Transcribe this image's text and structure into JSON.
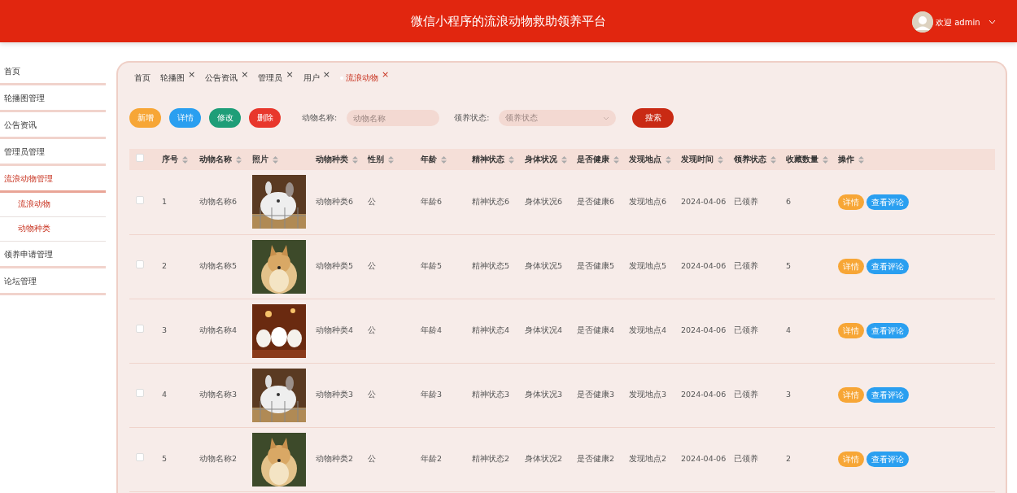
{
  "header": {
    "title": "微信小程序的流浪动物救助领养平台",
    "user": "欢迎 admin"
  },
  "sidebar": {
    "items": [
      {
        "label": "首页",
        "selected": false
      },
      {
        "label": "轮播图管理",
        "selected": false
      },
      {
        "label": "公告资讯",
        "selected": false
      },
      {
        "label": "管理员管理",
        "selected": false
      },
      {
        "label": "流浪动物管理",
        "selected": true,
        "expanded": true,
        "children": [
          {
            "label": "流浪动物",
            "selected": false
          },
          {
            "label": "动物种类",
            "selected": false
          }
        ]
      },
      {
        "label": "领养申请管理",
        "selected": false
      },
      {
        "label": "论坛管理",
        "selected": false
      }
    ]
  },
  "tabs": [
    {
      "label": "首页",
      "closable": false,
      "selected": false
    },
    {
      "label": "轮播图",
      "closable": true,
      "selected": false
    },
    {
      "label": "公告资讯",
      "closable": true,
      "selected": false
    },
    {
      "label": "管理员",
      "closable": true,
      "selected": false
    },
    {
      "label": "用户",
      "closable": true,
      "selected": false
    },
    {
      "label": "流浪动物",
      "closable": true,
      "selected": true
    }
  ],
  "close_glyph": "×",
  "actions": [
    {
      "label": "新增",
      "color": "#f7a636"
    },
    {
      "label": "详情",
      "color": "#2a9ff0"
    },
    {
      "label": "修改",
      "color": "#1e9e78"
    },
    {
      "label": "删除",
      "color": "#e8372c"
    }
  ],
  "filters": [
    {
      "label": "动物名称:",
      "placeholder": "动物名称",
      "kind": "text"
    },
    {
      "label": "领养状态:",
      "placeholder": "领养状态",
      "kind": "select"
    }
  ],
  "search_button": "搜索",
  "table": {
    "all_checked": false,
    "columns": [
      "序号",
      "动物名称",
      "照片",
      "动物种类",
      "性别",
      "年龄",
      "精神状态",
      "身体状况",
      "是否健康",
      "发现地点",
      "发现时间",
      "领养状态",
      "收藏数量",
      "操作"
    ],
    "rows": [
      {
        "checked": false,
        "cells": [
          "1",
          "动物名称6",
          null,
          "动物种类6",
          "公",
          "年龄6",
          "精神状态6",
          "身体状况6",
          "是否健康6",
          "发现地点6",
          "2024-04-06",
          "已领养",
          "6"
        ],
        "buttons": [
          "详情",
          "查看评论"
        ]
      },
      {
        "checked": false,
        "cells": [
          "2",
          "动物名称5",
          null,
          "动物种类5",
          "公",
          "年龄5",
          "精神状态5",
          "身体状况5",
          "是否健康5",
          "发现地点5",
          "2024-04-06",
          "已领养",
          "5"
        ],
        "buttons": [
          "详情",
          "查看评论"
        ]
      },
      {
        "checked": false,
        "cells": [
          "3",
          "动物名称4",
          null,
          "动物种类4",
          "公",
          "年龄4",
          "精神状态4",
          "身体状况4",
          "是否健康4",
          "发现地点4",
          "2024-04-06",
          "已领养",
          "4"
        ],
        "buttons": [
          "详情",
          "查看评论"
        ]
      },
      {
        "checked": false,
        "cells": [
          "4",
          "动物名称3",
          null,
          "动物种类3",
          "公",
          "年龄3",
          "精神状态3",
          "身体状况3",
          "是否健康3",
          "发现地点3",
          "2024-04-06",
          "已领养",
          "3"
        ],
        "buttons": [
          "详情",
          "查看评论"
        ]
      },
      {
        "checked": false,
        "cells": [
          "5",
          "动物名称2",
          null,
          "动物种类2",
          "公",
          "年龄2",
          "精神状态2",
          "身体状况2",
          "是否健康2",
          "发现地点2",
          "2024-04-06",
          "已领养",
          "2"
        ],
        "buttons": [
          "详情",
          "查看评论"
        ]
      }
    ]
  }
}
